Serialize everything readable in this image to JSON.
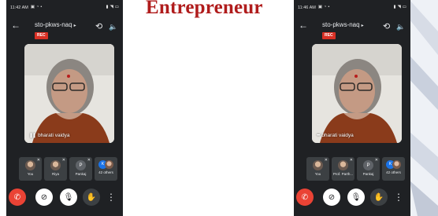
{
  "slide": {
    "title": "Entrepreneur"
  },
  "phones": {
    "left": {
      "status_time": "11:42 AM",
      "meeting_code": "sto-pkws-naq",
      "rec_label": "REC",
      "speaker_name": "bharati vaidya",
      "participants": [
        {
          "label": "You"
        },
        {
          "label": "Riya"
        },
        {
          "initial": "P",
          "label": "Pankaj"
        },
        {
          "initial": "K",
          "label": "42 others"
        }
      ]
    },
    "right": {
      "status_time": "11:46 AM",
      "meeting_code": "sto-pkws-naq",
      "rec_label": "REC",
      "speaker_name": "bharati vaidya",
      "participants": [
        {
          "label": "You"
        },
        {
          "label": "Prof. Parth..."
        },
        {
          "initial": "P",
          "label": "Pankaj"
        },
        {
          "initial": "K",
          "label": "42 others"
        }
      ]
    }
  },
  "icons": {
    "back": "←",
    "flip_camera": "⟲",
    "speaker": "🔈",
    "end_call": "✆",
    "camera_off": "⊘",
    "mic_off": "🎙",
    "raise_hand": "✋",
    "more": "⋮",
    "muted": "🎙"
  },
  "colors": {
    "app_bg": "#1f2124",
    "rec_red": "#d93025",
    "end_call_red": "#ea4335",
    "title_red": "#b01c1c"
  }
}
